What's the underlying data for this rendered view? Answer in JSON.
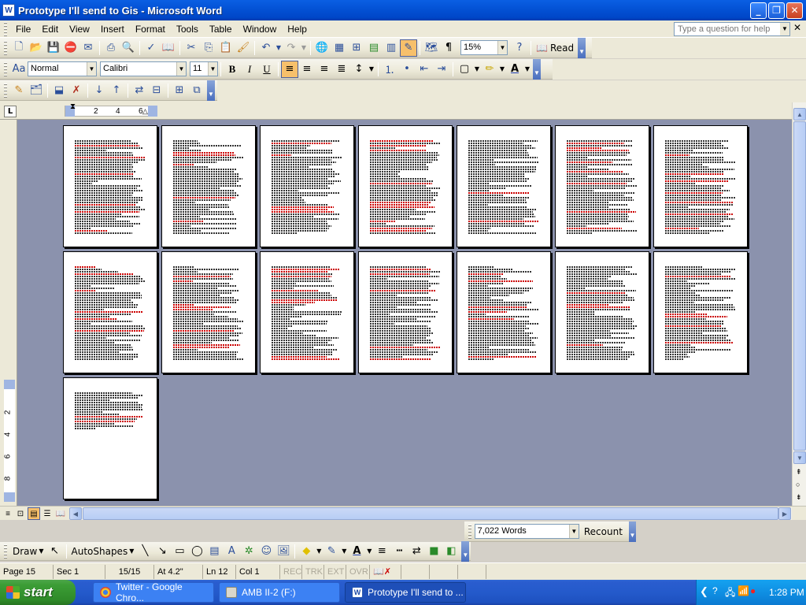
{
  "window": {
    "title": "Prototype I'll send to Gis - Microsoft Word"
  },
  "menu": {
    "items": [
      "File",
      "Edit",
      "View",
      "Insert",
      "Format",
      "Tools",
      "Table",
      "Window",
      "Help"
    ],
    "help_placeholder": "Type a question for help"
  },
  "standard_toolbar": {
    "zoom": "15%",
    "read_label": "Read"
  },
  "formatting_toolbar": {
    "style": "Normal",
    "font": "Calibri",
    "size": "11"
  },
  "ruler": {
    "numbers": [
      "2",
      "4",
      "6"
    ]
  },
  "vertical_ruler": {
    "numbers": [
      "2",
      "4",
      "6",
      "8"
    ]
  },
  "document": {
    "page_count": 15,
    "pages_per_row": 7
  },
  "word_count": {
    "value": "7,022 Words",
    "recount_label": "Recount"
  },
  "drawing_toolbar": {
    "draw_label": "Draw",
    "autoshapes_label": "AutoShapes"
  },
  "status": {
    "page": "Page  15",
    "sec": "Sec  1",
    "pages": "15/15",
    "at": "At  4.2\"",
    "ln": "Ln  12",
    "col": "Col  1",
    "modes": [
      "REC",
      "TRK",
      "EXT",
      "OVR"
    ]
  },
  "taskbar": {
    "start_label": "start",
    "tasks": [
      {
        "label": "Twitter - Google Chro...",
        "active": false
      },
      {
        "label": "AMB II-2 (F:)",
        "active": false
      },
      {
        "label": "Prototype I'll send to ...",
        "active": true
      }
    ],
    "clock": "1:28 PM"
  },
  "colors": {
    "title_bar": "#0453d6",
    "doc_background": "#8b92ad",
    "taskbar": "#245acb",
    "start": "#3c9d36",
    "tray": "#0f8fe3"
  }
}
